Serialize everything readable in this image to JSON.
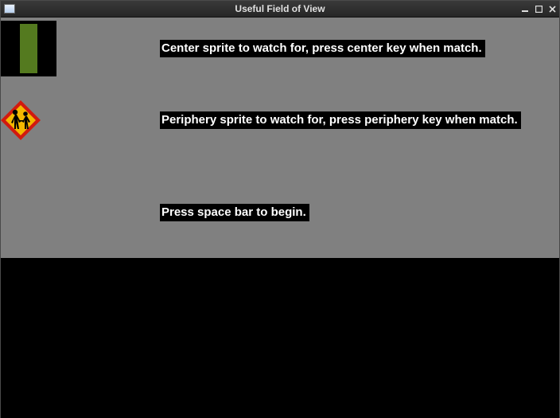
{
  "window": {
    "title": "Useful Field of View",
    "icon": "app-icon",
    "controls": {
      "minimize": "minimize-icon",
      "maximize": "maximize-icon",
      "close": "close-icon"
    }
  },
  "content": {
    "center_sprite": {
      "name": "green-stripe-sprite",
      "label": "Center sprite to watch for, press center key when match."
    },
    "periphery_sprite": {
      "name": "children-crossing-sign-sprite",
      "label": "Periphery sprite to watch for, press periphery key when match."
    },
    "begin": {
      "label": "Press space bar to begin."
    }
  },
  "colors": {
    "panel_bg": "#808080",
    "below_bg": "#000000",
    "sprite_green": "#547a1f",
    "sign_bg": "#f5b800",
    "sign_accent": "#d11a0f"
  }
}
